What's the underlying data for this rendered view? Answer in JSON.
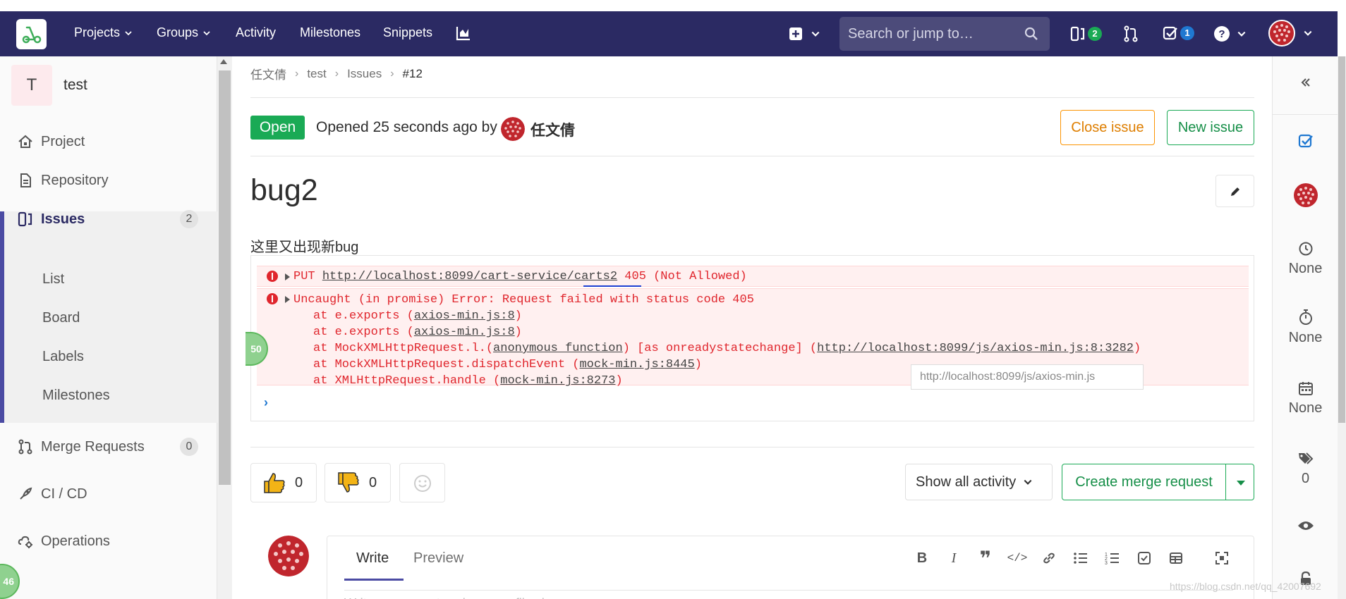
{
  "header": {
    "nav": {
      "projects": "Projects",
      "groups": "Groups",
      "activity": "Activity",
      "milestones": "Milestones",
      "snippets": "Snippets"
    },
    "search_placeholder": "Search or jump to…",
    "issues_badge": "2",
    "todos_badge": "1",
    "badge_colors": {
      "issues": "#1aaa55",
      "todos": "#1f78d1"
    }
  },
  "sidebar": {
    "project_initial": "T",
    "project_name": "test",
    "items": {
      "project": "Project",
      "repository": "Repository",
      "issues": "Issues",
      "issues_count": "2",
      "list": "List",
      "board": "Board",
      "labels": "Labels",
      "milestones": "Milestones",
      "merge_requests": "Merge Requests",
      "merge_requests_count": "0",
      "cicd": "CI / CD",
      "operations": "Operations"
    }
  },
  "breadcrumb": {
    "user": "任文倩",
    "project": "test",
    "issues": "Issues",
    "current": "#12"
  },
  "issue": {
    "status": "Open",
    "opened_text": "Opened 25 seconds ago by",
    "author": "任文倩",
    "close_label": "Close issue",
    "new_label": "New issue",
    "title": "bug2",
    "description": "这里又出现新bug"
  },
  "console": {
    "line1_prefix": "PUT ",
    "line1_url": "http://localhost:8099/cart-service/carts2",
    "line1_suffix": " 405 (Not Allowed)",
    "line2": "Uncaught (in promise) Error: Request failed with status code 405",
    "stack1_prefix": "at e.exports (",
    "stack1_link": "axios-min.js:8",
    "stack2_prefix": "at e.exports (",
    "stack2_link": "axios-min.js:8",
    "stack3_prefix": "at MockXMLHttpRequest.l.(",
    "stack3_link": "anonymous function",
    "stack3_mid": ") [as onreadystatechange] (",
    "stack3_url": "http://localhost:8099/js/axios-min.js:8:3282",
    "stack4_prefix": "at MockXMLHttpRequest.dispatchEvent (",
    "stack4_link": "mock-min.js:8445",
    "stack5_prefix": "at XMLHttpRequest.handle (",
    "stack5_link": "mock-min.js:8273",
    "close_paren": ")",
    "tooltip": "http://localhost:8099/js/axios-min.js",
    "badge": "50"
  },
  "reactions": {
    "thumbs_up": "0",
    "thumbs_down": "0",
    "activity_label": "Show all activity",
    "merge_label": "Create merge request"
  },
  "comment": {
    "write_tab": "Write",
    "preview_tab": "Preview",
    "placeholder": "Write a comment or drag your files here..."
  },
  "right_sidebar": {
    "milestone": "None",
    "time_tracking": "None",
    "due_date": "None",
    "labels_count": "0"
  },
  "watermark": "https://blog.csdn.net/qq_42007692",
  "corner_badge": "46"
}
